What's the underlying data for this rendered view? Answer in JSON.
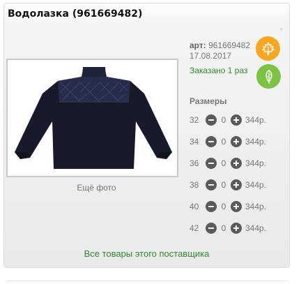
{
  "product": {
    "title": "Водолазка (961669482)",
    "art_label": "арт:",
    "art_value": "961669482",
    "date": "17.08.2017",
    "ordered": "Заказано 1 раз",
    "more_photos": "Ещё фото"
  },
  "badges": [
    {
      "icon": "maple-leaf-icon",
      "color": "#f5a623"
    },
    {
      "icon": "leaf-icon",
      "color": "#7dc242"
    }
  ],
  "sizes": {
    "title": "Размеры",
    "rows": [
      {
        "size": "32",
        "qty": "0",
        "price": "344р."
      },
      {
        "size": "34",
        "qty": "0",
        "price": "344р."
      },
      {
        "size": "36",
        "qty": "0",
        "price": "344р."
      },
      {
        "size": "38",
        "qty": "0",
        "price": "344р."
      },
      {
        "size": "40",
        "qty": "0",
        "price": "344р."
      },
      {
        "size": "42",
        "qty": "0",
        "price": "344р."
      }
    ]
  },
  "footer": {
    "supplier_link": "Все товары этого поставщика"
  }
}
